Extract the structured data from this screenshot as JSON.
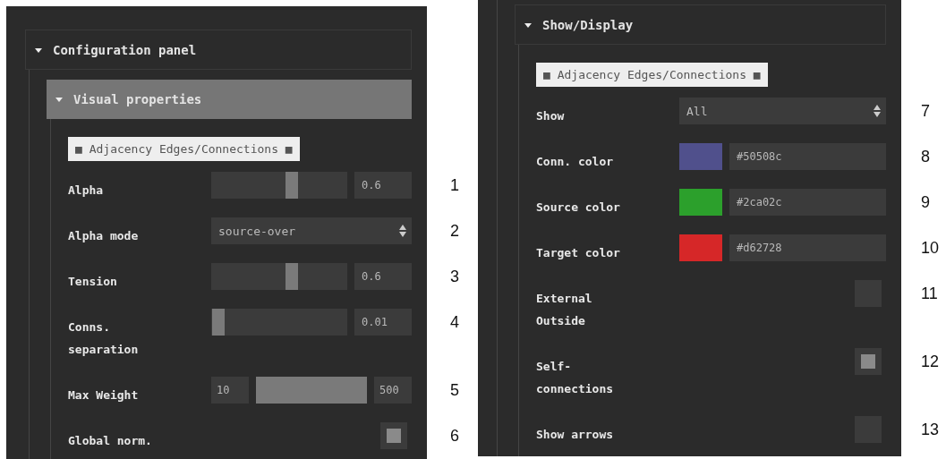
{
  "panels": [
    {
      "continued": false,
      "sections": [
        {
          "title": "Configuration panel",
          "expanded": true,
          "selected": false,
          "children": [
            {
              "title": "Visual properties",
              "expanded": true,
              "selected": true,
              "groups": [
                {
                  "label": "■ Adjacency Edges/Connections ■",
                  "rows": [
                    {
                      "kind": "slider",
                      "label": "Alpha",
                      "level": 0.6,
                      "value": "0.6",
                      "annotation": "1"
                    },
                    {
                      "kind": "select",
                      "label": "Alpha mode",
                      "value": "source-over",
                      "annotation": "2"
                    },
                    {
                      "kind": "slider",
                      "label": "Tension",
                      "level": 0.6,
                      "value": "0.6",
                      "annotation": "3"
                    },
                    {
                      "kind": "slider",
                      "label": "Conns. separation",
                      "level": 0.01,
                      "value": "0.01",
                      "annotation": "4"
                    },
                    {
                      "kind": "range",
                      "label": "Max Weight",
                      "min": "10",
                      "max": "500",
                      "level": 1,
                      "annotation": "5"
                    },
                    {
                      "kind": "checkbox",
                      "label": "Global norm.",
                      "checked": true,
                      "annotation": "6"
                    }
                  ]
                }
              ]
            }
          ]
        }
      ]
    },
    {
      "continued": true,
      "sections": [
        {
          "title": "Show/Display",
          "expanded": true,
          "selected": false,
          "groups": [
            {
              "label": "■ Adjacency Edges/Connections ■",
              "rows": [
                {
                  "kind": "select",
                  "label": "Show",
                  "value": "All",
                  "annotation": "7"
                },
                {
                  "kind": "color",
                  "label": "Conn. color",
                  "color": "#50508c",
                  "value": "#50508c",
                  "annotation": "8"
                },
                {
                  "kind": "color",
                  "label": "Source color",
                  "color": "#2ca02c",
                  "value": "#2ca02c",
                  "annotation": "9"
                },
                {
                  "kind": "color",
                  "label": "Target color",
                  "color": "#d62728",
                  "value": "#d62728",
                  "annotation": "10"
                },
                {
                  "kind": "checkbox",
                  "label": "External Outside",
                  "checked": false,
                  "annotation": "11"
                },
                {
                  "kind": "checkbox",
                  "label": "Self-connections",
                  "checked": true,
                  "annotation": "12"
                },
                {
                  "kind": "checkbox",
                  "label": "Show arrows",
                  "checked": false,
                  "annotation": "13"
                }
              ]
            }
          ]
        }
      ]
    }
  ]
}
